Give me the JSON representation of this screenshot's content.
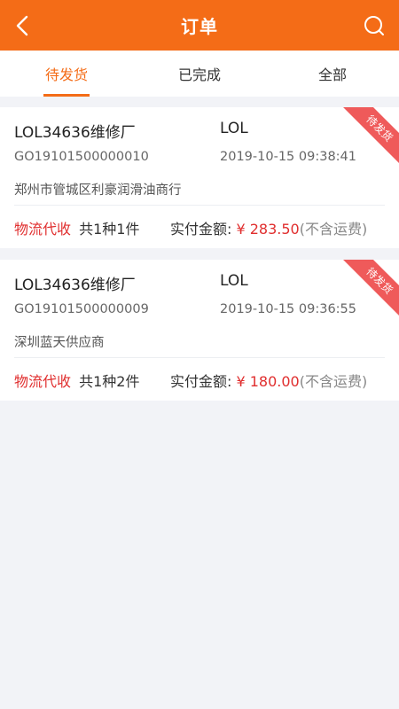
{
  "header": {
    "title": "订单",
    "back_icon": "chevron-left-icon",
    "search_icon": "search-icon"
  },
  "tabs": [
    {
      "label": "待发货",
      "active": true
    },
    {
      "label": "已完成",
      "active": false
    },
    {
      "label": "全部",
      "active": false
    }
  ],
  "orders": [
    {
      "name": "LOL34636维修厂",
      "shop": "LOL",
      "code": "GO19101500000010",
      "time": "2019-10-15 09:38:41",
      "supplier": "郑州市管城区利豪润滑油商行",
      "tag": "物流代收",
      "count": "共1种1件",
      "amount_label": "实付金额: ",
      "amount": "¥ 283.50",
      "fee_note": "(不含运费)",
      "status": "待发货"
    },
    {
      "name": "LOL34636维修厂",
      "shop": "LOL",
      "code": "GO19101500000009",
      "time": "2019-10-15 09:36:55",
      "supplier": "深圳蓝天供应商",
      "tag": "物流代收",
      "count": "共1种2件",
      "amount_label": "实付金额: ",
      "amount": "¥ 180.00",
      "fee_note": "(不含运费)",
      "status": "待发货"
    }
  ],
  "colors": {
    "accent": "#f46c17",
    "price": "#e02e2e",
    "ribbon": "#ef5a5a"
  }
}
